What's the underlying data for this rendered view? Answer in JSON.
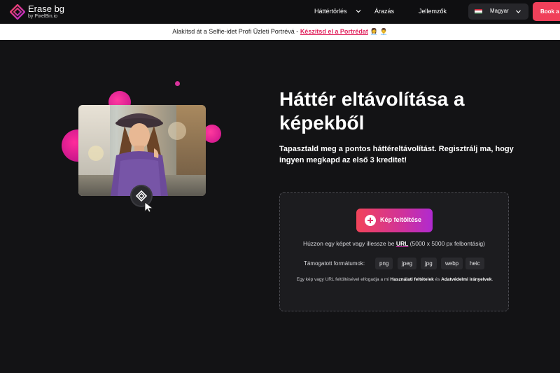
{
  "brand": {
    "name": "Erase bg",
    "byline": "by PixelBin.io",
    "accent": "#e0245e"
  },
  "nav": {
    "items": [
      {
        "label": "Háttértörlés",
        "has_dropdown": true
      },
      {
        "label": "Árazás",
        "has_dropdown": false
      },
      {
        "label": "Jellemzők",
        "has_dropdown": false
      }
    ],
    "language": {
      "label": "Magyar",
      "flag": "hungary-flag"
    },
    "cta": {
      "label": "Book a"
    }
  },
  "promo": {
    "text": "Alakítsd át a Selfie-idet Profi Üzleti Portrévá - ",
    "link": "Készítsd el a Portrédat",
    "emoji": "👩‍💼 👨‍💼"
  },
  "hero": {
    "title": "Háttér eltávolítása a képekből",
    "subtitle": "Tapasztald meg a pontos háttéreltávolítást. Regisztrálj ma, hogy ingyen megkapd az első 3 kreditet!"
  },
  "uploader": {
    "button_label": "Kép feltöltése",
    "drag_prefix": "Húzzon egy képet vagy illessze be ",
    "drag_url": "URL",
    "drag_suffix": " (5000 x 5000 px felbontásig)",
    "formats_label": "Támogatott formátumok:",
    "formats": [
      "png",
      "jpeg",
      "jpg",
      "webp",
      "heic"
    ],
    "terms_prefix": "Egy kép vagy URL feltöltésével elfogadja a mi ",
    "terms_link1": "Használati feltételek",
    "terms_and": " és ",
    "terms_link2": "Adatvédelmi irányelvek",
    "terms_suffix": "."
  }
}
